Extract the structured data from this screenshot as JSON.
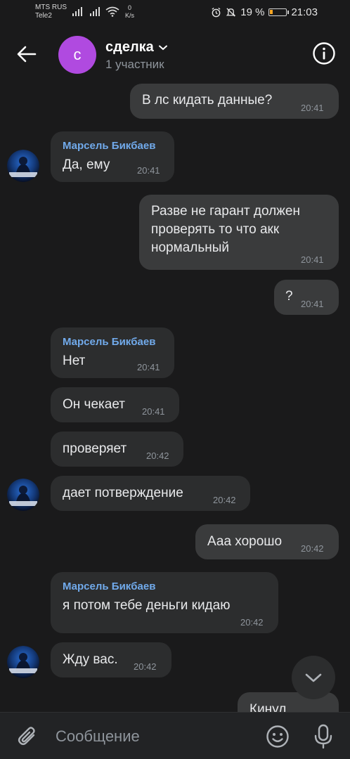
{
  "status_bar": {
    "carrier1": "MTS RUS",
    "carrier2": "Tele2",
    "speed_value": "0",
    "speed_unit": "K/s",
    "battery": "19 %",
    "battery_level": 0.19,
    "time": "21:03"
  },
  "header": {
    "avatar_letter": "с",
    "title": "сделка",
    "subtitle": "1 участник"
  },
  "messages": [
    {
      "direction": "out",
      "text": "В лс кидать данные?",
      "time": "20:41"
    },
    {
      "direction": "in",
      "sender": "Марсель Бикбаев",
      "text": "Да, ему",
      "time": "20:41"
    },
    {
      "direction": "out",
      "text": "Разве не гарант должен проверять то что акк нормальный",
      "time": "20:41"
    },
    {
      "direction": "out",
      "text": "?",
      "time": "20:41"
    },
    {
      "direction": "in",
      "sender": "Марсель Бикбаев",
      "text": "Нет",
      "time": "20:41"
    },
    {
      "direction": "in",
      "text": "Он чекает",
      "time": "20:41"
    },
    {
      "direction": "in",
      "text": "проверяет",
      "time": "20:42"
    },
    {
      "direction": "in",
      "text": "дает потверждение",
      "time": "20:42"
    },
    {
      "direction": "out",
      "text": "Ааа хорошо",
      "time": "20:42"
    },
    {
      "direction": "in",
      "sender": "Марсель Бикбаев",
      "text": "я потом тебе деньги кидаю",
      "time": "20:42"
    },
    {
      "direction": "in",
      "text": "Жду вас.",
      "time": "20:42"
    },
    {
      "direction": "out",
      "text": "Кинул",
      "time": ""
    }
  ],
  "composer": {
    "placeholder": "Сообщение"
  },
  "icons": {
    "back": "arrow-left-icon",
    "info": "info-icon",
    "scroll": "chevron-down-icon",
    "attach": "paperclip-icon",
    "sticker": "smile-icon",
    "mic": "microphone-icon"
  }
}
